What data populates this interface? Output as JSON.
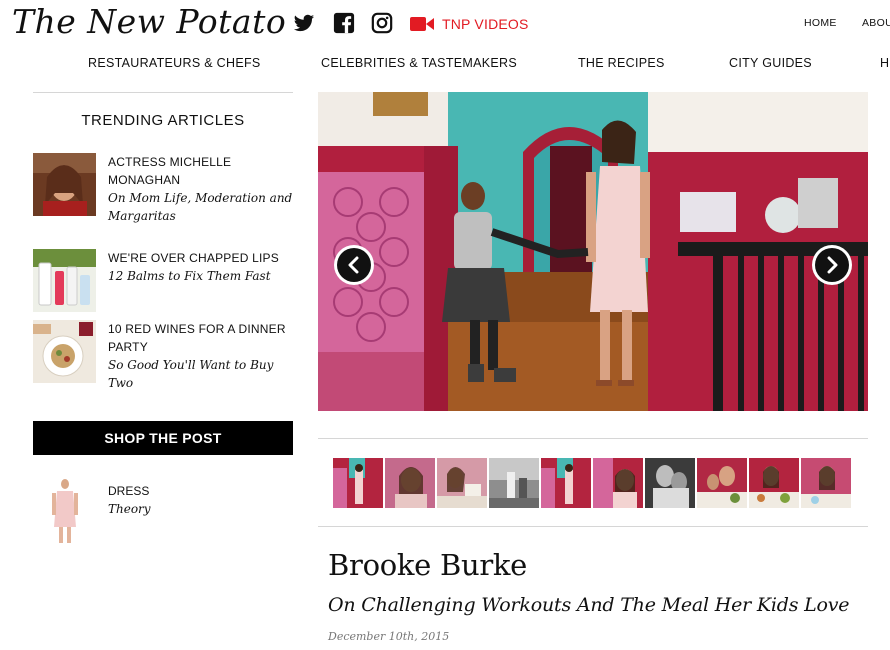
{
  "header": {
    "logo": "The New Potato",
    "social": [
      {
        "name": "twitter-icon"
      },
      {
        "name": "facebook-icon"
      },
      {
        "name": "instagram-icon"
      }
    ],
    "videos_label": "TNP VIDEOS",
    "nav": [
      "HOME",
      "ABOU"
    ]
  },
  "categories": [
    "RESTAURATEURS & CHEFS",
    "CELEBRITIES & TASTEMAKERS",
    "THE RECIPES",
    "CITY GUIDES",
    "H"
  ],
  "sidebar": {
    "trending_title": "TRENDING ARTICLES",
    "articles": [
      {
        "title": "ACTRESS MICHELLE MONAGHAN",
        "subtitle": "On Mom Life, Moderation and Margaritas"
      },
      {
        "title": "WE'RE OVER CHAPPED LIPS",
        "subtitle": "12 Balms to Fix Them Fast"
      },
      {
        "title": "10 RED WINES FOR A DINNER PARTY",
        "subtitle": "So Good You'll Want to Buy Two"
      }
    ],
    "shop_label": "SHOP THE POST",
    "product": {
      "name": "DRESS",
      "brand": "Theory"
    }
  },
  "post": {
    "title": "Brooke Burke",
    "subtitle": "On Challenging Workouts And The Meal Her Kids Love",
    "date": "December 10th, 2015"
  },
  "colors": {
    "accent": "#e21b23",
    "button": "#000000",
    "wall_red": "#b3243f",
    "wall_teal": "#4fb9b5"
  }
}
